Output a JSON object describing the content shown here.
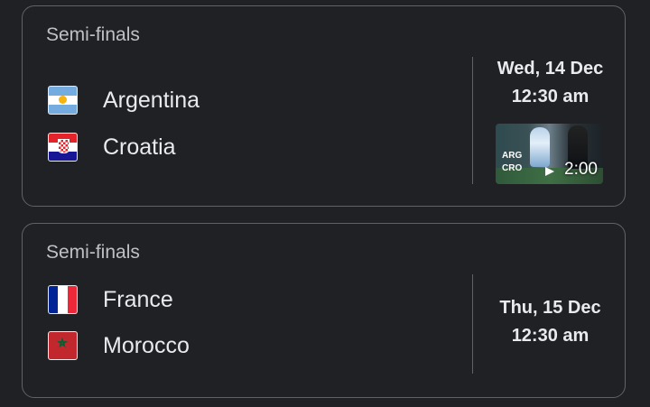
{
  "matches": [
    {
      "stage": "Semi-finals",
      "team1": "Argentina",
      "team2": "Croatia",
      "date": "Wed, 14 Dec",
      "time": "12:30 am",
      "video": {
        "label1": "ARG",
        "label2": "CRO",
        "duration": "2:00"
      }
    },
    {
      "stage": "Semi-finals",
      "team1": "France",
      "team2": "Morocco",
      "date": "Thu, 15 Dec",
      "time": "12:30 am"
    }
  ]
}
